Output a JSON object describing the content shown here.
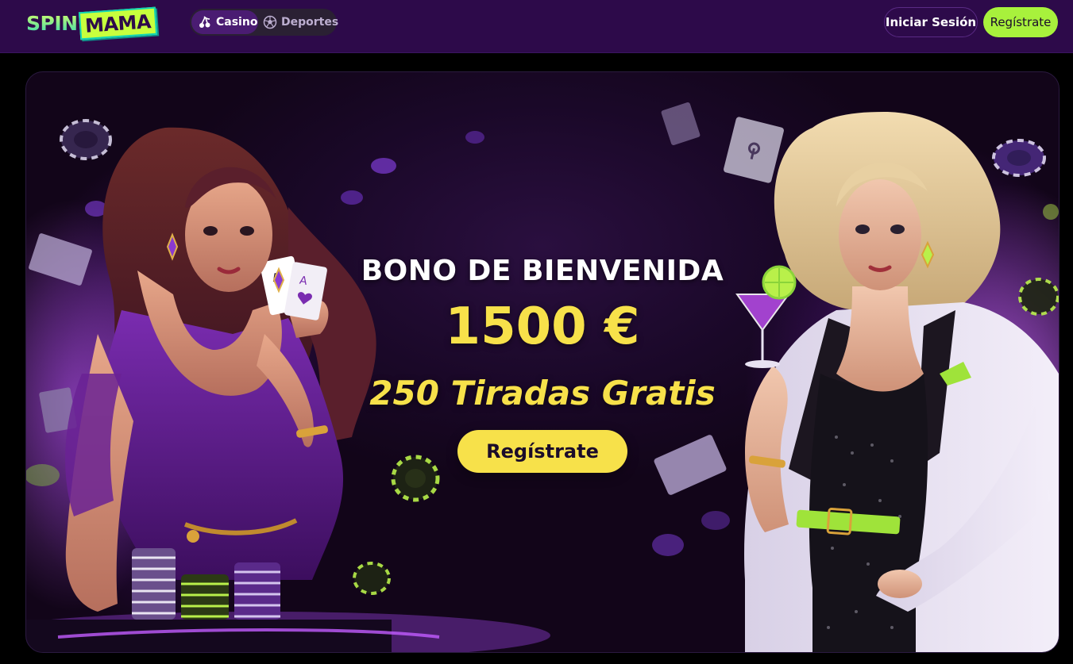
{
  "header": {
    "logo": {
      "part1": "SPIN",
      "part2": "MAMA"
    },
    "nav": [
      {
        "label": "Casino",
        "icon": "cherries-icon",
        "active": true
      },
      {
        "label": "Deportes",
        "icon": "soccer-ball-icon",
        "active": false
      }
    ],
    "login_label": "Iniciar Sesión",
    "register_label": "Regístrate"
  },
  "hero": {
    "title": "BONO DE BIENVENIDA",
    "amount": "1500 €",
    "spins": "250 Tiradas Gratis",
    "cta_label": "Regístrate"
  },
  "colors": {
    "header_bg": "#2d0a4a",
    "accent_green": "#a8f13c",
    "accent_yellow": "#f7e14a",
    "page_bg": "#000000"
  }
}
